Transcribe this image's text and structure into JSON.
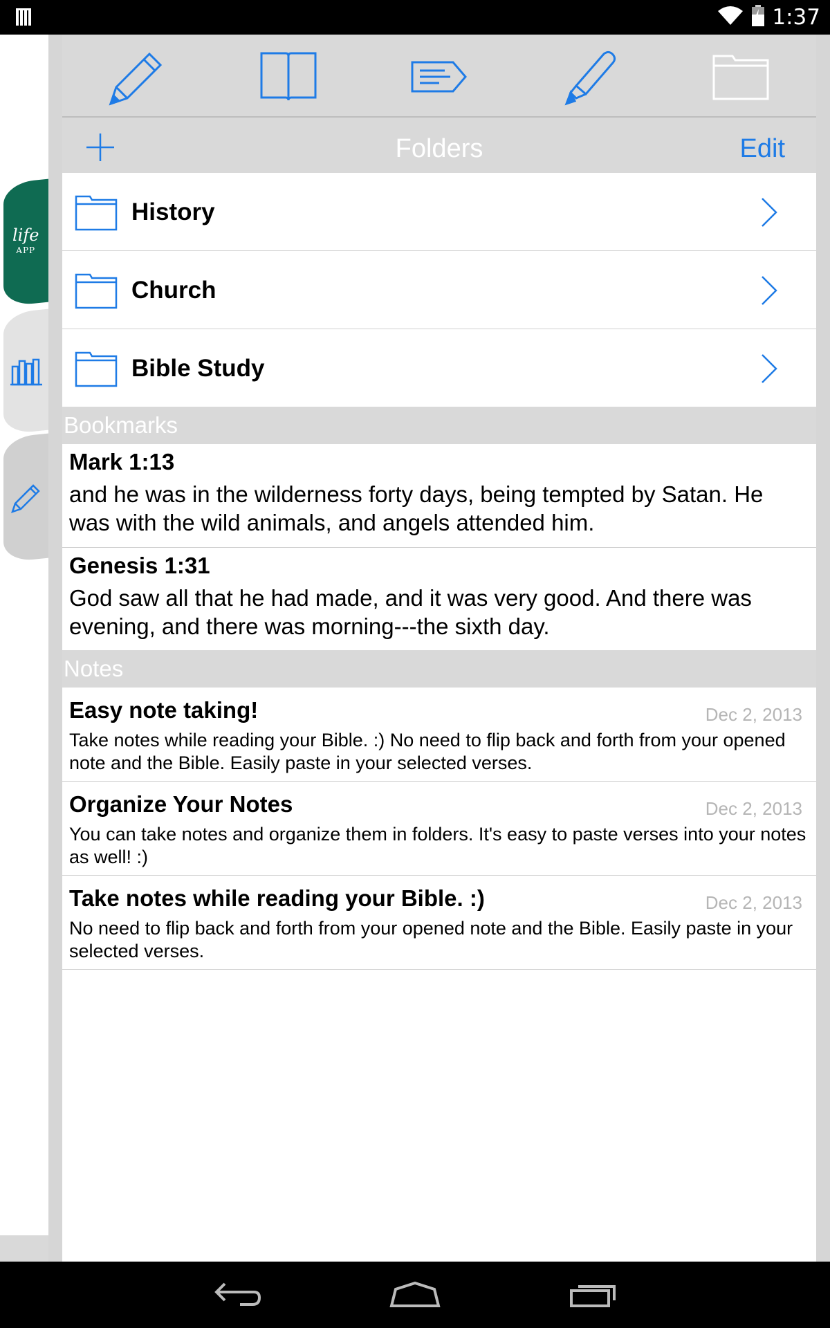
{
  "status_bar": {
    "time": "1:37"
  },
  "header": {
    "title": "Folders",
    "edit_label": "Edit"
  },
  "folders": [
    {
      "name": "History"
    },
    {
      "name": "Church"
    },
    {
      "name": "Bible Study"
    }
  ],
  "bookmarks": {
    "section_label": "Bookmarks",
    "items": [
      {
        "reference": "Mark 1:13",
        "text": "and he was in the wilderness forty days, being tempted by Satan. He was with the wild animals, and angels attended him."
      },
      {
        "reference": "Genesis 1:31",
        "text": "God saw all that he had made, and it was very good. And there was evening, and there was morning---the sixth day."
      }
    ]
  },
  "notes": {
    "section_label": "Notes",
    "items": [
      {
        "title": "Easy note taking!",
        "date": "Dec 2, 2013",
        "body": "Take notes while reading your Bible. :)   No need to flip back and forth from your opened note and the Bible. Easily paste in your selected verses."
      },
      {
        "title": "Organize Your Notes",
        "date": "Dec 2, 2013",
        "body": "You can take notes and organize them in folders. It's easy to paste verses into your notes as well! :)"
      },
      {
        "title": "Take notes while reading your Bible. :)",
        "date": "Dec 2, 2013",
        "body": "No need to flip back and forth from your opened note and the Bible. Easily paste in your selected verses."
      }
    ]
  },
  "side_tabs": {
    "logo_text": "life",
    "logo_sub": "APP"
  },
  "colors": {
    "accent": "#1e7be6",
    "brand_green": "#0f6b52",
    "panel_gray": "#d9d9d9"
  },
  "icons": {
    "toolbar": [
      "pencil-icon",
      "book-icon",
      "tag-icon",
      "highlighter-icon",
      "folder-icon"
    ],
    "nav": [
      "back-icon",
      "home-icon",
      "recents-icon"
    ]
  }
}
